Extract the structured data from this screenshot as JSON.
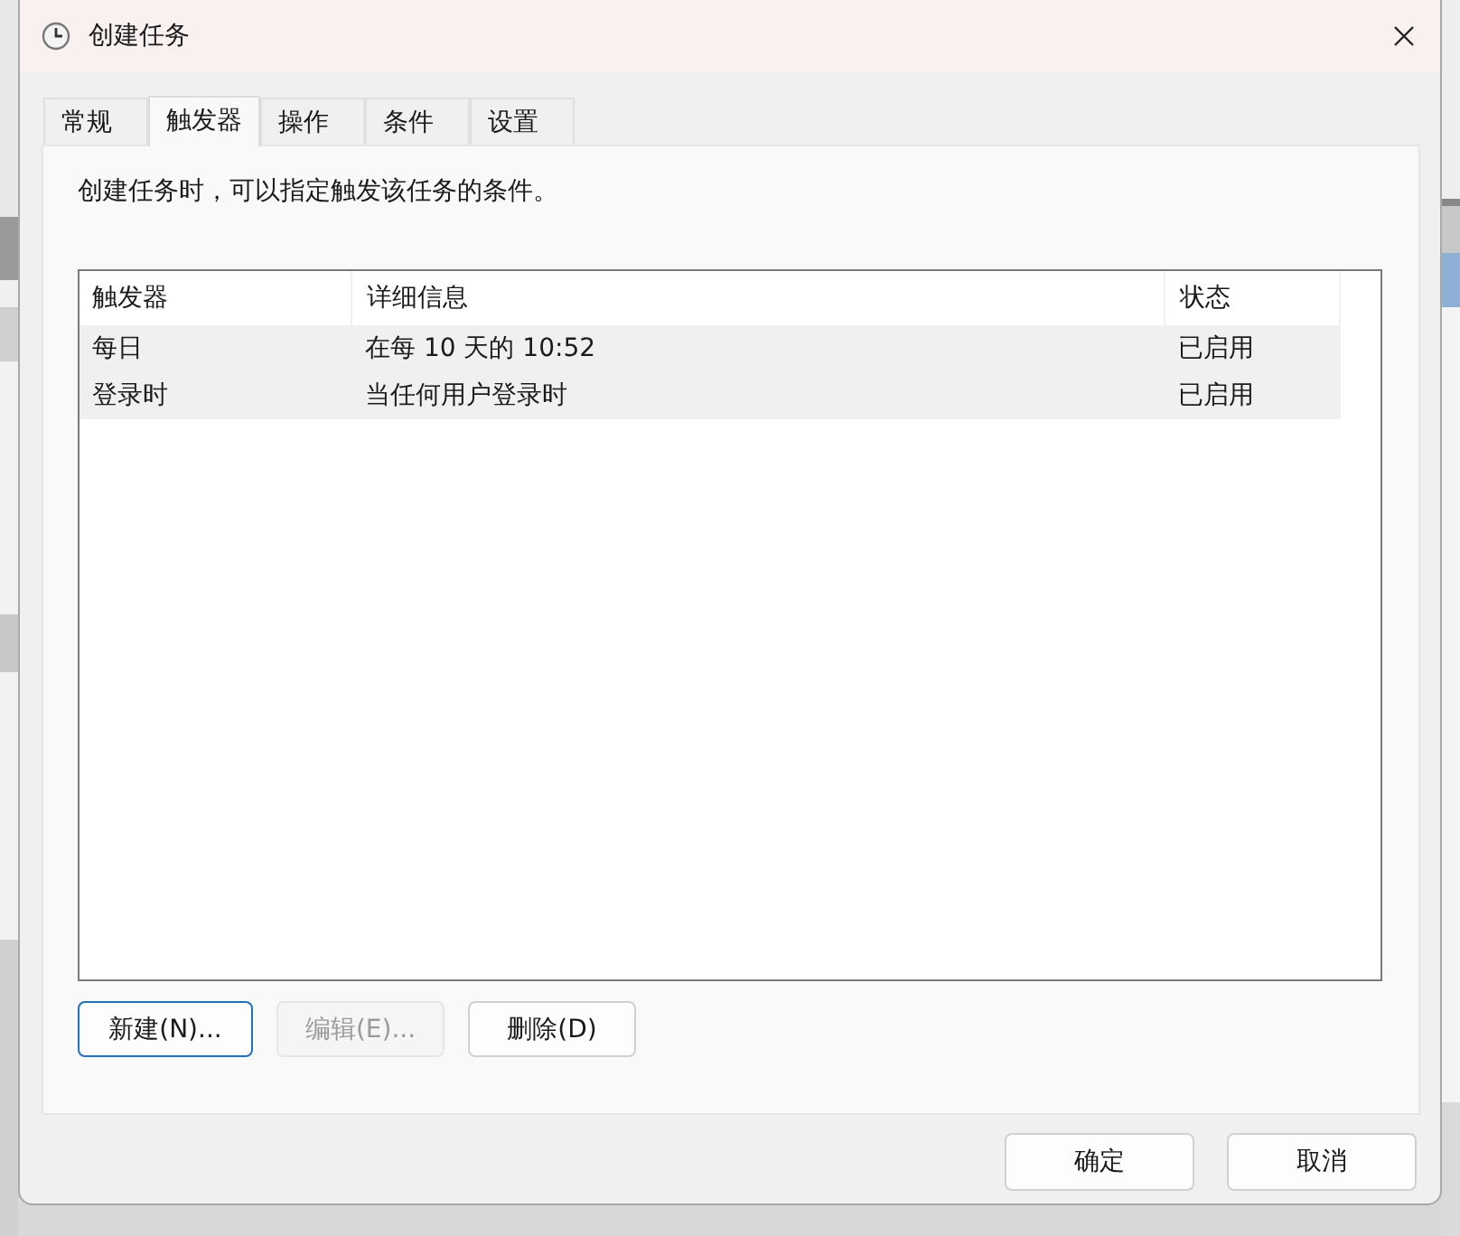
{
  "window": {
    "title": "创建任务"
  },
  "tabs": [
    {
      "label": "常规",
      "selected": false
    },
    {
      "label": "触发器",
      "selected": true
    },
    {
      "label": "操作",
      "selected": false
    },
    {
      "label": "条件",
      "selected": false
    },
    {
      "label": "设置",
      "selected": false
    }
  ],
  "description": "创建任务时，可以指定触发该任务的条件。",
  "table": {
    "columns": [
      "触发器",
      "详细信息",
      "状态"
    ],
    "rows": [
      {
        "cells": [
          "每日",
          "在每 10 天的 10:52",
          "已启用"
        ],
        "selected": false
      },
      {
        "cells": [
          "登录时",
          "当任何用户登录时",
          "已启用"
        ],
        "selected": false
      }
    ]
  },
  "list_buttons": [
    {
      "label": "新建(N)...",
      "disabled": false,
      "focused": true
    },
    {
      "label": "编辑(E)...",
      "disabled": true,
      "focused": false
    },
    {
      "label": "删除(D)",
      "disabled": false,
      "focused": false
    }
  ],
  "dialog_buttons": [
    "确定",
    "取消"
  ]
}
